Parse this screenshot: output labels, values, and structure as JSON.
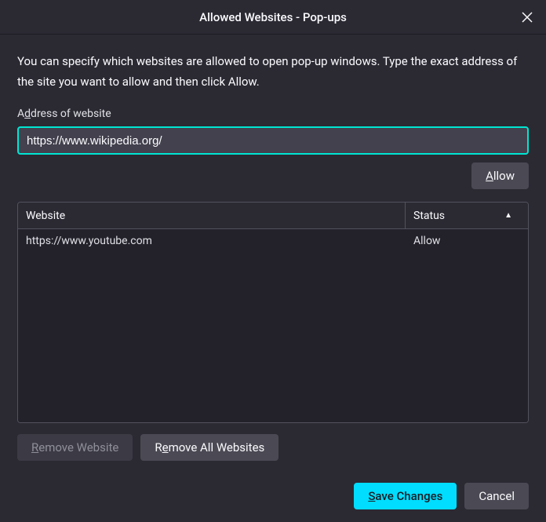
{
  "titlebar": {
    "title": "Allowed Websites - Pop-ups"
  },
  "description": "You can specify which websites are allowed to open pop-up windows. Type the exact address of the site you want to allow and then click Allow.",
  "address": {
    "label_pre": "A",
    "label_u": "d",
    "label_post": "dress of website",
    "value": "https://www.wikipedia.org/"
  },
  "buttons": {
    "allow_u": "A",
    "allow_post": "llow",
    "remove_website_u": "R",
    "remove_website_post": "emove Website",
    "remove_all_u": "e",
    "remove_all_pre": "R",
    "remove_all_post": "move All Websites",
    "save_u": "S",
    "save_post": "ave Changes",
    "cancel": "Cancel"
  },
  "table": {
    "headers": {
      "website": "Website",
      "status": "Status"
    },
    "rows": [
      {
        "website": "https://www.youtube.com",
        "status": "Allow"
      }
    ]
  }
}
